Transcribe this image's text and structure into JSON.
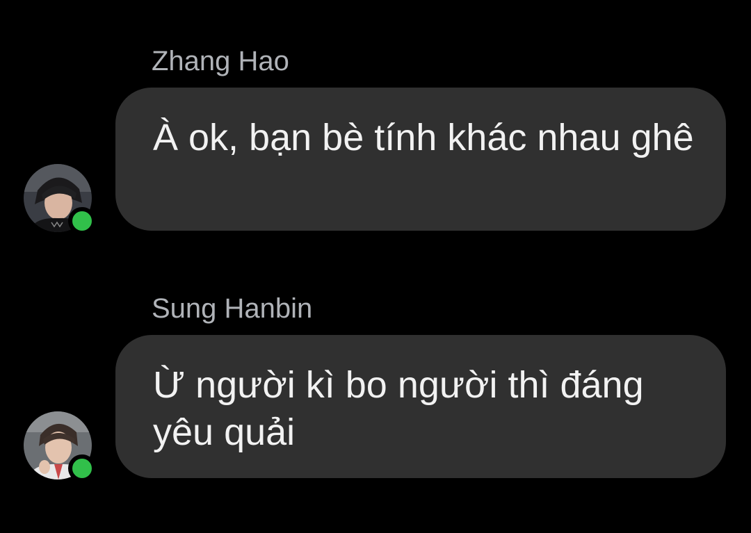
{
  "messages": [
    {
      "sender": "Zhang Hao",
      "text": "À ok, bạn bè tính khác nhau ghê",
      "online": true,
      "avatar": "zhang-hao-avatar"
    },
    {
      "sender": "Sung Hanbin",
      "text": "Ừ người kì bo người thì đáng yêu quải",
      "online": true,
      "avatar": "sung-hanbin-avatar"
    }
  ],
  "colors": {
    "background": "#000000",
    "bubble": "#303030",
    "text": "#f2f2f2",
    "sender_name": "#b0b3b8",
    "online": "#31c04a"
  }
}
